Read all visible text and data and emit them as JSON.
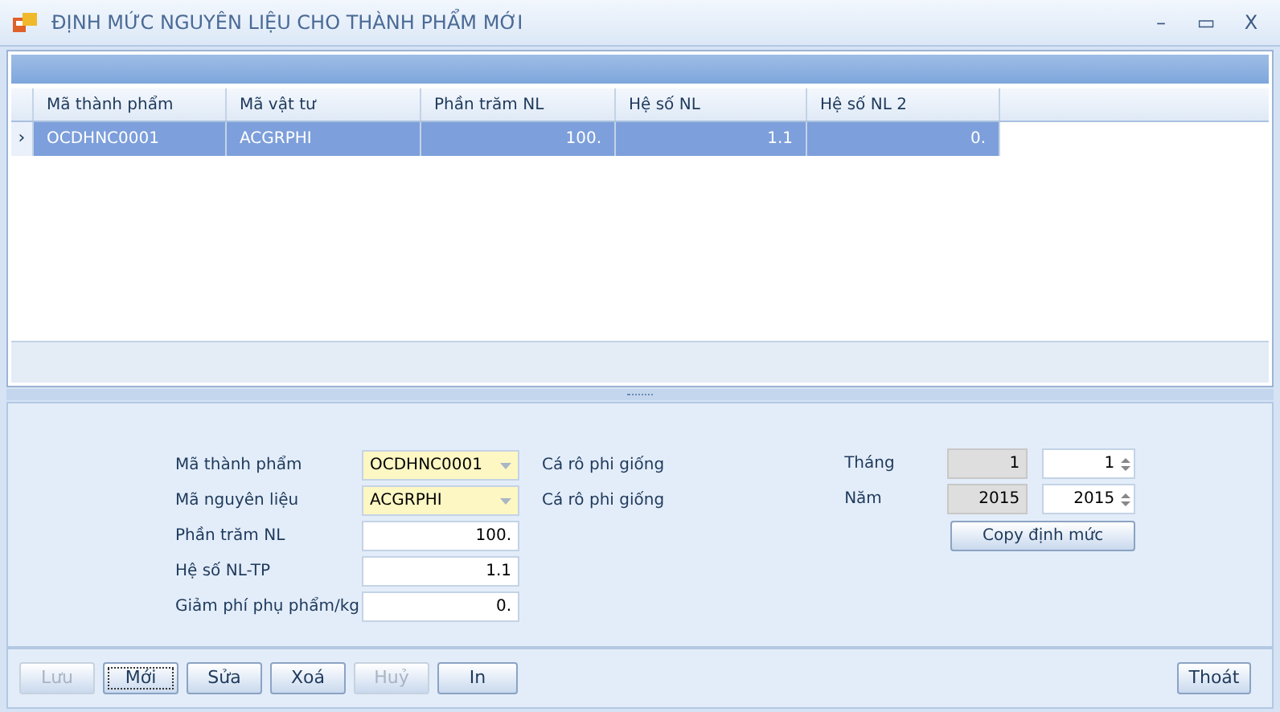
{
  "window": {
    "title": "ĐỊNH MỨC NGUYÊN LIỆU CHO THÀNH PHẨM MỚI",
    "controls": [
      "–",
      "▭",
      "X"
    ]
  },
  "grid": {
    "columns": [
      "Mã thành phẩm",
      "Mã vật tư",
      "Phần trăm NL",
      "Hệ số NL",
      "Hệ số NL 2"
    ],
    "rows": [
      {
        "selected": true,
        "indicator": "›",
        "cells": [
          "OCDHNC0001",
          "ACGRPHI",
          "100.",
          "1.1",
          "0."
        ]
      }
    ]
  },
  "form": {
    "fields": [
      {
        "kind": "combo",
        "label": "Mã thành phẩm",
        "value": "OCDHNC0001",
        "description": "Cá rô phi giống"
      },
      {
        "kind": "combo",
        "label": "Mã nguyên liệu",
        "value": "ACGRPHI",
        "description": "Cá rô phi giống"
      },
      {
        "kind": "number",
        "label": "Phần trăm NL",
        "value": "100."
      },
      {
        "kind": "number",
        "label": "Hệ số NL-TP",
        "value": "1.1"
      },
      {
        "kind": "number",
        "label": "Giảm phí phụ phẩm/kg",
        "value": "0."
      }
    ],
    "period": [
      {
        "label": "Tháng",
        "current": "1",
        "value": "1"
      },
      {
        "label": "Năm",
        "current": "2015",
        "value": "2015"
      }
    ],
    "copy_button": "Copy định mức"
  },
  "buttons": [
    {
      "label": "Lưu",
      "disabled": true,
      "focused": false
    },
    {
      "label": "Mới",
      "disabled": false,
      "focused": true
    },
    {
      "label": "Sửa",
      "disabled": false,
      "focused": false
    },
    {
      "label": "Xoá",
      "disabled": false,
      "focused": false
    },
    {
      "label": "Huỷ",
      "disabled": true,
      "focused": false
    },
    {
      "label": "In",
      "disabled": false,
      "focused": false
    }
  ],
  "exit_button": "Thoát"
}
